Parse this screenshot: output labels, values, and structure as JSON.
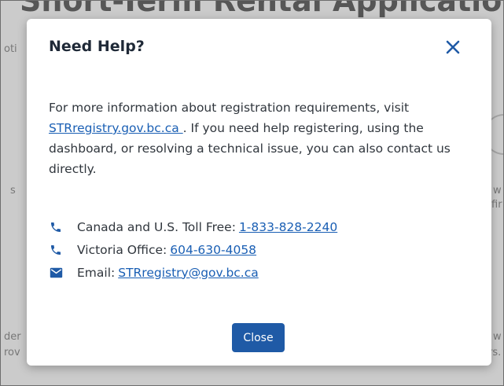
{
  "background": {
    "title": "Short-Term Rental Application",
    "snippets": {
      "top_left": "oti",
      "left_mid": "s",
      "right_mid_1": "w",
      "right_mid_2": "fir",
      "bottom_left_1": "der",
      "bottom_left_2": "rov",
      "bottom_right_1": "w",
      "bottom_right_2": "rs."
    }
  },
  "modal": {
    "title": "Need Help?",
    "close_icon": "close-x-icon",
    "intro": {
      "before_link": "For more information about registration requirements, visit ",
      "link_text": "STRregistry.gov.bc.ca ",
      "after_link": ". If you need help registering, using the dashboard, or resolving a technical issue, you can also contact us directly."
    },
    "contacts": [
      {
        "icon": "phone-icon",
        "label": "Canada and U.S. Toll Free:",
        "value": "1-833-828-2240"
      },
      {
        "icon": "phone-icon",
        "label": "Victoria Office:",
        "value": "604-630-4058"
      },
      {
        "icon": "envelope-icon",
        "label": "Email:",
        "value": "STRregistry@gov.bc.ca"
      }
    ],
    "close_button_label": "Close"
  },
  "colors": {
    "accent": "#1f5aa6",
    "link": "#1a5fb4"
  }
}
